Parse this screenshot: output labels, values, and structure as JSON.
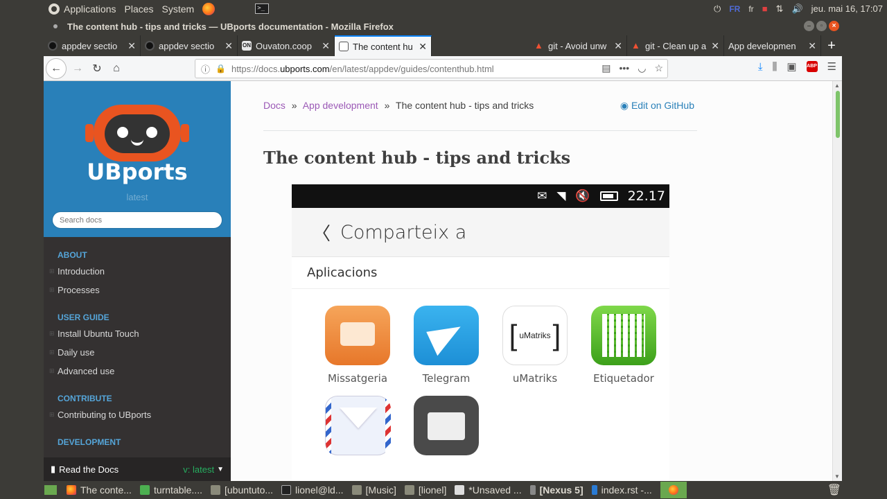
{
  "top_panel": {
    "menus": [
      "Applications",
      "Places",
      "System"
    ],
    "keyboard_layouts": [
      "FR",
      "fr"
    ],
    "clock": "jeu. mai 16, 17:07"
  },
  "window": {
    "title": "The content hub - tips and tricks — UBports documentation - Mozilla Firefox"
  },
  "tabs": [
    {
      "title": "appdev sectio",
      "icon": "github-icon",
      "active": false
    },
    {
      "title": "appdev sectio",
      "icon": "github-icon",
      "active": false
    },
    {
      "title": "Ouvaton.coop",
      "icon": "ouvaton-icon",
      "active": false
    },
    {
      "title": "The content hu",
      "icon": "document-icon",
      "active": true
    },
    {
      "title": "git - Avoid unw",
      "icon": "stackoverflow-icon",
      "active": false
    },
    {
      "title": "git - Clean up a",
      "icon": "stackoverflow-icon",
      "active": false
    },
    {
      "title": "App developmen",
      "icon": "",
      "active": false
    }
  ],
  "navbar": {
    "url_prefix": "https://docs.",
    "url_host": "ubports.com",
    "url_path": "/en/latest/appdev/guides/contenthub.html"
  },
  "sidebar": {
    "brand": "UBports",
    "version": "latest",
    "search_placeholder": "Search docs",
    "sections": [
      {
        "caption": "ABOUT",
        "items": [
          "Introduction",
          "Processes"
        ]
      },
      {
        "caption": "USER GUIDE",
        "items": [
          "Install Ubuntu Touch",
          "Daily use",
          "Advanced use"
        ]
      },
      {
        "caption": "CONTRIBUTE",
        "items": [
          "Contributing to UBports"
        ]
      },
      {
        "caption": "DEVELOPMENT",
        "items": []
      }
    ],
    "rtd_label": "Read the Docs",
    "rtd_version": "v: latest"
  },
  "content": {
    "breadcrumbs": [
      "Docs",
      "App development",
      "The content hub - tips and tricks"
    ],
    "edit_link": "Edit on GitHub",
    "heading": "The content hub - tips and tricks"
  },
  "phone": {
    "time": "22.17",
    "header_title": "Comparteix a",
    "section_title": "Aplicacions",
    "apps": [
      {
        "label": "Missatgeria",
        "icon": "messaging-app-icon"
      },
      {
        "label": "Telegram",
        "icon": "telegram-app-icon"
      },
      {
        "label": "uMatriks",
        "icon": "umatriks-app-icon"
      },
      {
        "label": "Etiquetador",
        "icon": "qr-tagger-app-icon"
      },
      {
        "label": "",
        "icon": "mail-app-icon"
      },
      {
        "label": "",
        "icon": "files-app-icon"
      }
    ],
    "umatriks_text": "uMatriks"
  },
  "taskbar": [
    {
      "label": "The conte...",
      "icon": "firefox-icon"
    },
    {
      "label": "turntable....",
      "icon": "chat-icon"
    },
    {
      "label": "[ubuntuto...",
      "icon": "folder-icon"
    },
    {
      "label": "lionel@ld...",
      "icon": "terminal-icon"
    },
    {
      "label": "[Music]",
      "icon": "folder-icon"
    },
    {
      "label": "[lionel]",
      "icon": "folder-icon"
    },
    {
      "label": "*Unsaved ...",
      "icon": "text-editor-icon"
    },
    {
      "label": "[Nexus 5]",
      "icon": "phone-icon"
    },
    {
      "label": "index.rst -...",
      "icon": "code-editor-icon"
    }
  ]
}
